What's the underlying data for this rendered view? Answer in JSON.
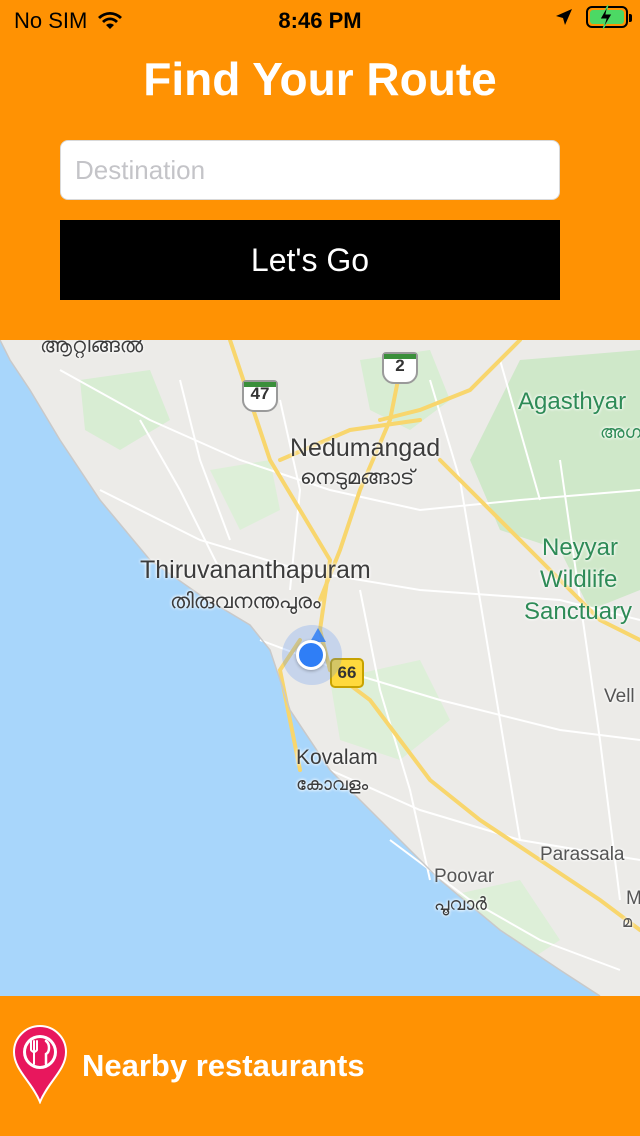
{
  "status_bar": {
    "carrier": "No SIM",
    "time": "8:46 PM",
    "battery_level": 1.0,
    "charging": true
  },
  "header": {
    "title": "Find Your Route",
    "destination_placeholder": "Destination",
    "destination_value": "",
    "go_button_label": "Let's Go"
  },
  "map": {
    "labels": {
      "top_partial_mal": "ആറ്റിങ്ങൽ",
      "nedumangad": "Nedumangad",
      "nedumangad_mal": "നെടുമങ്ങാട്",
      "agasthyar": "Agasthyar",
      "agasthyar_mal": "അഗ",
      "thiruvananthapuram": "Thiruvananthapuram",
      "thiruvananthapuram_mal": "തിരുവനന്തപുരം",
      "neyyar_1": "Neyyar",
      "neyyar_2": "Wildlife",
      "neyyar_3": "Sanctuary",
      "vell": "Vell",
      "kovalam": "Kovalam",
      "kovalam_mal": "കോവളം",
      "parassala": "Parassala",
      "poovar": "Poovar",
      "poovar_mal": "പൂവാർ",
      "edge_m": "M",
      "edge_m_mal": "മ"
    },
    "route_shields": {
      "sh47": "47",
      "sh2": "2",
      "nh66": "66"
    }
  },
  "footer": {
    "label": "Nearby restaurants"
  },
  "colors": {
    "accent": "#FF9203",
    "button": "#000000",
    "sea": "#A8D6FB",
    "land": "#ECEBE8",
    "park": "#CFE8C9",
    "road": "#FCE08A",
    "location": "#2F7EF6",
    "pin": "#E8175D"
  }
}
